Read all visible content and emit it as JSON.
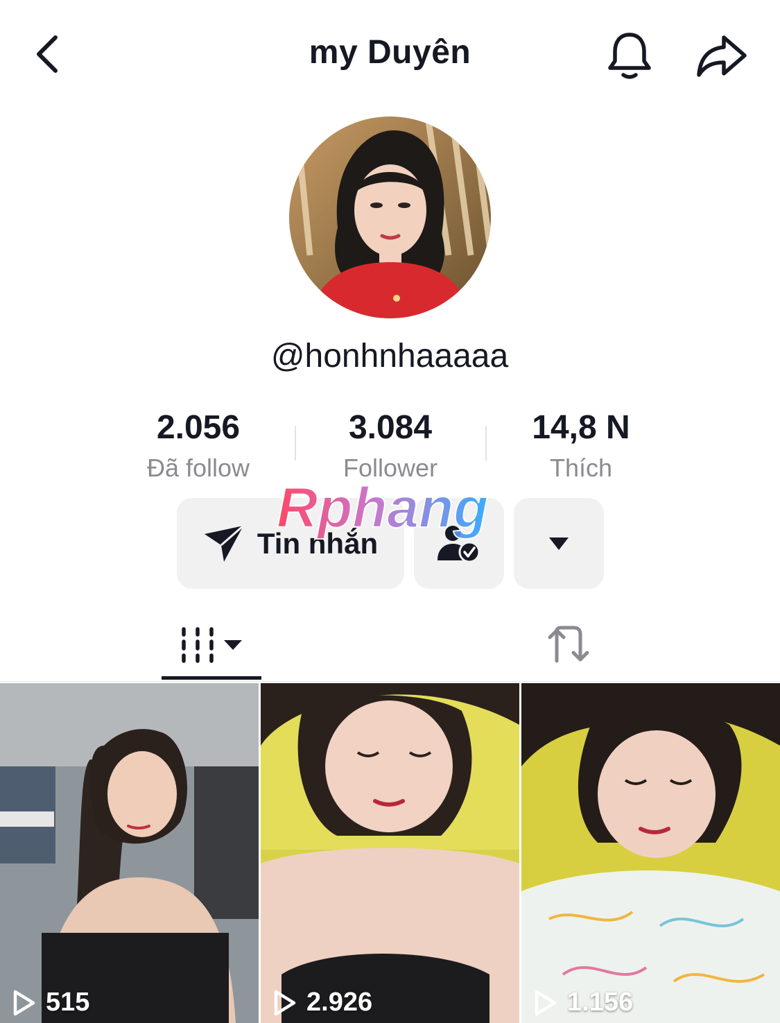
{
  "header": {
    "title": "my Duyên",
    "back_icon": "chevron-left-icon",
    "bell_icon": "bell-icon",
    "share_icon": "share-icon"
  },
  "profile": {
    "username": "@honhnhaaaaa"
  },
  "stats": [
    {
      "value": "2.056",
      "label": "Đã follow"
    },
    {
      "value": "3.084",
      "label": "Follower"
    },
    {
      "value": "14,8 N",
      "label": "Thích"
    }
  ],
  "watermark": "Rphang",
  "actions": {
    "message_label": "Tin nhắn",
    "message_icon": "send-icon",
    "friend_icon": "user-check-icon",
    "more_icon": "caret-down-icon"
  },
  "tabs": {
    "videos_icon": "grid-bars-icon",
    "reposts_icon": "repost-icon"
  },
  "videos": [
    {
      "views": "515"
    },
    {
      "views": "2.926"
    },
    {
      "views": "1.156"
    }
  ],
  "colors": {
    "text": "#161823",
    "secondary": "#8a8b91",
    "button_bg": "#f1f1f2",
    "watermark_gradient": [
      "#ff3b5c",
      "#2aa7ff"
    ]
  }
}
